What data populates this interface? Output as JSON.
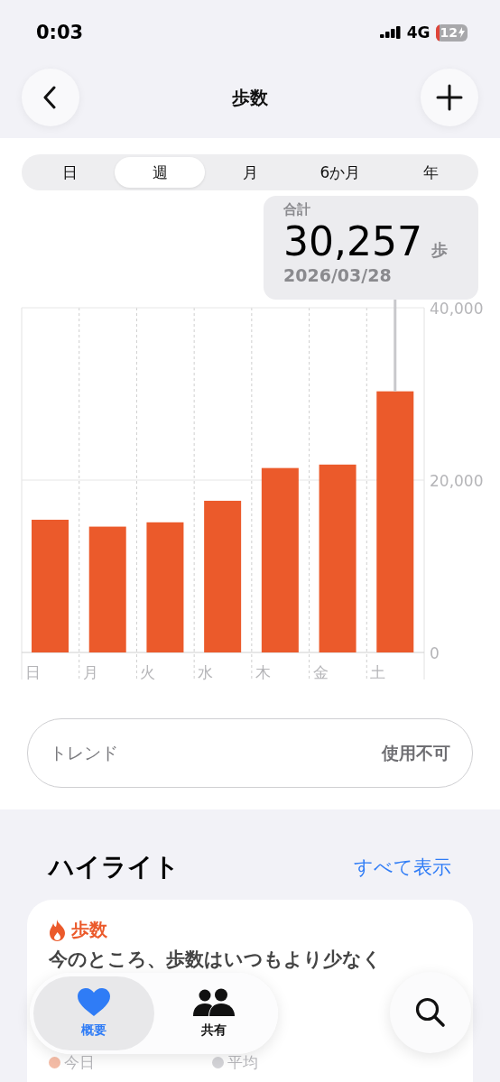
{
  "status_bar": {
    "time": "0:03",
    "network": "4G",
    "battery": "12",
    "battery_low": true,
    "charging": true
  },
  "nav": {
    "title": "歩数"
  },
  "periods": [
    {
      "label": "日",
      "selected": false
    },
    {
      "label": "週",
      "selected": true
    },
    {
      "label": "月",
      "selected": false
    },
    {
      "label": "6か月",
      "selected": false
    },
    {
      "label": "年",
      "selected": false
    }
  ],
  "summary": {
    "label": "合計",
    "value": "30,257",
    "unit": "歩",
    "date": "2026/03/28"
  },
  "chart_data": {
    "type": "bar",
    "categories": [
      "日",
      "月",
      "火",
      "水",
      "木",
      "金",
      "土"
    ],
    "ylim": [
      0,
      40000
    ],
    "yticks": [
      {
        "value": 0,
        "label": "0"
      },
      {
        "value": 20000,
        "label": "20,000"
      },
      {
        "value": 40000,
        "label": "40,000"
      }
    ],
    "series": [
      {
        "color": "#eb5a2b",
        "values": [
          15400,
          14600,
          15100,
          17600,
          21400,
          21800,
          30300
        ]
      }
    ],
    "annotations": [
      {
        "x": "土"
      }
    ]
  },
  "trend": {
    "label": "トレンド",
    "value": "使用不可"
  },
  "highlights": {
    "title": "ハイライト",
    "link": "すべて表示",
    "card": {
      "category": "歩数",
      "text": "今のところ、歩数はいつもより少なく",
      "legend": [
        {
          "label": "今日",
          "color": "#f4bca6"
        },
        {
          "label": "平均",
          "color": "#d4d4d8"
        }
      ]
    }
  },
  "tab_bar": [
    {
      "label": "概要",
      "kind": "heart",
      "selected": true
    },
    {
      "label": "共有",
      "kind": "people",
      "selected": false
    }
  ]
}
